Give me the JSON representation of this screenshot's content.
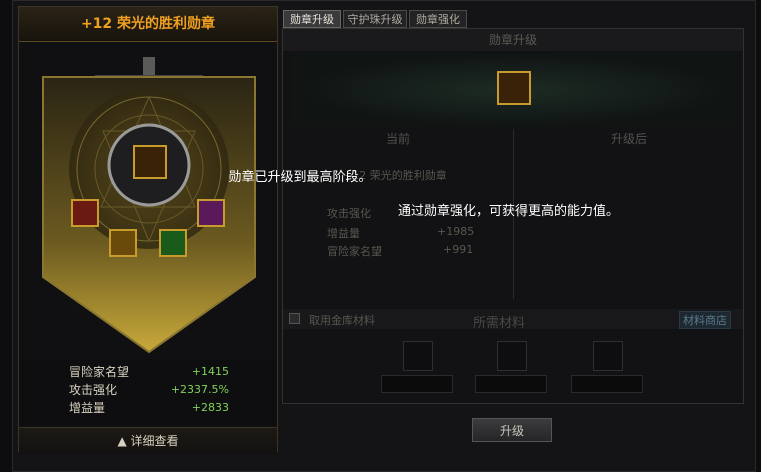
{
  "left": {
    "title": "+12 荣光的胜利勋章",
    "stats": [
      {
        "label": "冒险家名望",
        "value": "+1415"
      },
      {
        "label": "攻击强化",
        "value": "+2337.5%"
      },
      {
        "label": "增益量",
        "value": "+2833"
      }
    ],
    "detail_label": "▲ 详细查看"
  },
  "tabs": [
    {
      "label": "勋章升级",
      "active": true
    },
    {
      "label": "守护珠升级",
      "active": false
    },
    {
      "label": "勋章强化",
      "active": false
    }
  ],
  "right": {
    "section_title": "勋章升级",
    "col_current": "当前",
    "col_after": "升级后",
    "current_name": "+12 荣光的胜利勋章",
    "current_stats": [
      {
        "label": "攻击强化",
        "value": ""
      },
      {
        "label": "增益量",
        "value": "+1985"
      },
      {
        "label": "冒险家名望",
        "value": "+991"
      }
    ],
    "message_line1": "勋章已升级到最高阶段。",
    "message_line2": "通过勋章强化，可获得更高的能力值。",
    "use_vault_label": "取用金库材料",
    "materials_title": "所需材料",
    "shop_label": "材料商店",
    "upgrade_button": "升级"
  },
  "colors": {
    "accent_gold": "#f0a020",
    "stat_green": "#7fd35a"
  }
}
